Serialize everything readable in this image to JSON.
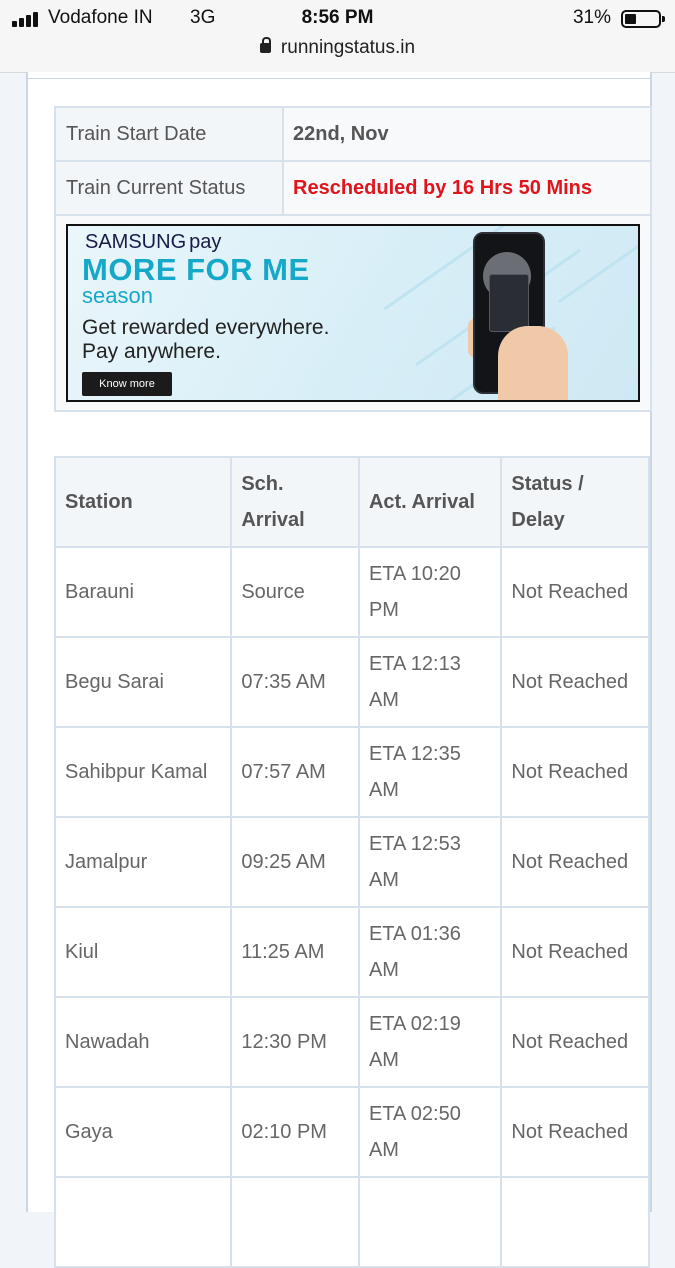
{
  "status_bar": {
    "carrier": "Vodafone IN",
    "network": "3G",
    "time": "8:56 PM",
    "battery_percent": "31%",
    "battery_level": 0.31,
    "signal_bars": 4
  },
  "browser": {
    "url": "runningstatus.in",
    "icon": "lock-icon"
  },
  "train_info": {
    "start_date_label": "Train Start Date",
    "start_date_value": "22nd, Nov",
    "current_status_label": "Train Current Status",
    "current_status_value": "Rescheduled by 16 Hrs 50 Mins",
    "status_color": "#e0141b"
  },
  "ad": {
    "brand": "SAMSUNG",
    "brand_suffix": "pay",
    "headline": "MORE FOR ME",
    "subheadline": "season",
    "line1": "Get rewarded everywhere.",
    "line2": "Pay anywhere.",
    "button_label": "Know more"
  },
  "schedule": {
    "headers": {
      "station": "Station",
      "sch_arrival_1": "Sch.",
      "sch_arrival_2": "Arrival",
      "act_arrival": "Act. Arrival",
      "status_1": "Status /",
      "status_2": "Delay"
    },
    "rows": [
      {
        "station": "Barauni",
        "sch": "Source",
        "eta_1": "ETA 10:20",
        "eta_2": "PM",
        "status": "Not Reached"
      },
      {
        "station": "Begu Sarai",
        "sch": "07:35 AM",
        "eta_1": "ETA 12:13",
        "eta_2": "AM",
        "status": "Not Reached"
      },
      {
        "station": "Sahibpur Kamal",
        "sch": "07:57 AM",
        "eta_1": "ETA 12:35",
        "eta_2": "AM",
        "status": "Not Reached"
      },
      {
        "station": "Jamalpur",
        "sch": "09:25 AM",
        "eta_1": "ETA 12:53",
        "eta_2": "AM",
        "status": "Not Reached"
      },
      {
        "station": "Kiul",
        "sch": "11:25 AM",
        "eta_1": "ETA 01:36",
        "eta_2": "AM",
        "status": "Not Reached"
      },
      {
        "station": "Nawadah",
        "sch": "12:30 PM",
        "eta_1": "ETA 02:19",
        "eta_2": "AM",
        "status": "Not Reached"
      },
      {
        "station": "Gaya",
        "sch": "02:10 PM",
        "eta_1": "ETA 02:50",
        "eta_2": "AM",
        "status": "Not Reached"
      }
    ]
  }
}
